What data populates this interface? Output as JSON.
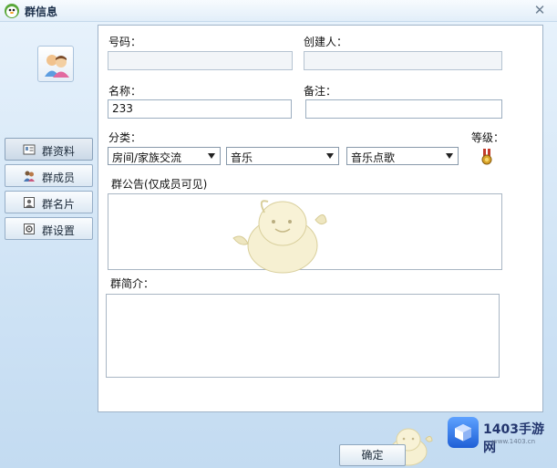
{
  "window": {
    "title": "群信息",
    "close_symbol": "✕"
  },
  "nav": {
    "items": [
      {
        "label": "群资料",
        "icon": "profile-card-icon",
        "active": true
      },
      {
        "label": "群成员",
        "icon": "members-icon",
        "active": false
      },
      {
        "label": "群名片",
        "icon": "namecard-icon",
        "active": false
      },
      {
        "label": "群设置",
        "icon": "settings-icon",
        "active": false
      }
    ]
  },
  "form": {
    "number_label": "号码：",
    "number_value": "",
    "creator_label": "创建人：",
    "creator_value": "",
    "name_label": "名称：",
    "name_value": "233",
    "remark_label": "备注：",
    "remark_value": "",
    "category_label": "分类：",
    "category_1": "房间/家族交流",
    "category_2": "音乐",
    "category_3": "音乐点歌",
    "level_label": "等级：",
    "announcement_label": "群公告(仅成员可见)",
    "intro_label": "群简介："
  },
  "footer": {
    "ok_label": "确定"
  },
  "watermark": {
    "name": "1403手游网",
    "url": "www.1403.cn"
  },
  "colors": {
    "accent": "#1f5fd6",
    "panel_border": "#9fb3c8",
    "window_bg": "#cfe3f5"
  }
}
